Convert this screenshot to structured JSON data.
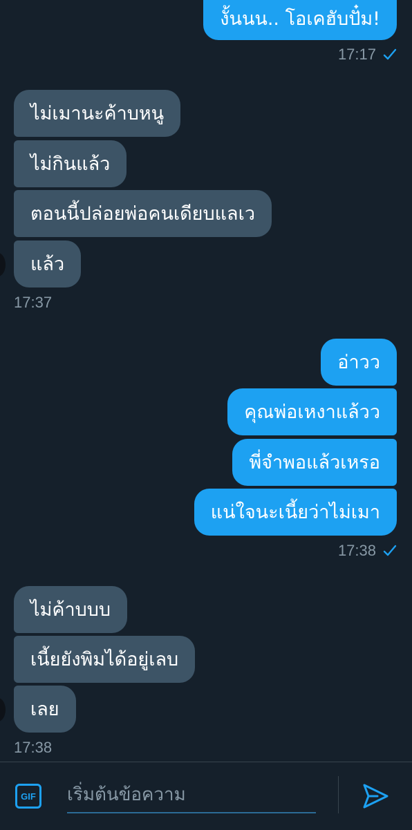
{
  "colors": {
    "background": "#15202b",
    "received_bubble": "#3d5466",
    "sent_bubble": "#1da1f2",
    "timestamp": "#8899a6",
    "accent": "#1da1f2"
  },
  "messages": [
    {
      "dir": "sent",
      "text": "งั้นนน.. โอเคฮับปั๋ม!"
    },
    {
      "dir": "received",
      "text": "ไม่เมานะค้าบหนู"
    },
    {
      "dir": "received",
      "text": "ไม่กินแล้ว"
    },
    {
      "dir": "received",
      "text": "ตอนนี้ปล่อยพ่อคนเดียบแลเว"
    },
    {
      "dir": "received",
      "text": "แล้ว"
    },
    {
      "dir": "sent",
      "text": "อ่าวว"
    },
    {
      "dir": "sent",
      "text": "คุณพ่อเหงาแล้วว"
    },
    {
      "dir": "sent",
      "text": "พี่จำพอแล้วเหรอ"
    },
    {
      "dir": "sent",
      "text": "แน่ใจนะเนี้ยว่าไม่เมา"
    },
    {
      "dir": "received",
      "text": "ไม่ค้าบบบ"
    },
    {
      "dir": "received",
      "text": "เนี้ยยังพิมได้อยู่เลบ"
    },
    {
      "dir": "received",
      "text": "เลย"
    }
  ],
  "timestamps": [
    "17:17",
    "17:37",
    "17:38",
    "17:38"
  ],
  "composer": {
    "gif_label": "GIF",
    "placeholder": "เริ่มต้นข้อความ"
  },
  "icons": {
    "read_receipt": "check-icon",
    "send": "send-icon",
    "gif": "gif-icon"
  }
}
